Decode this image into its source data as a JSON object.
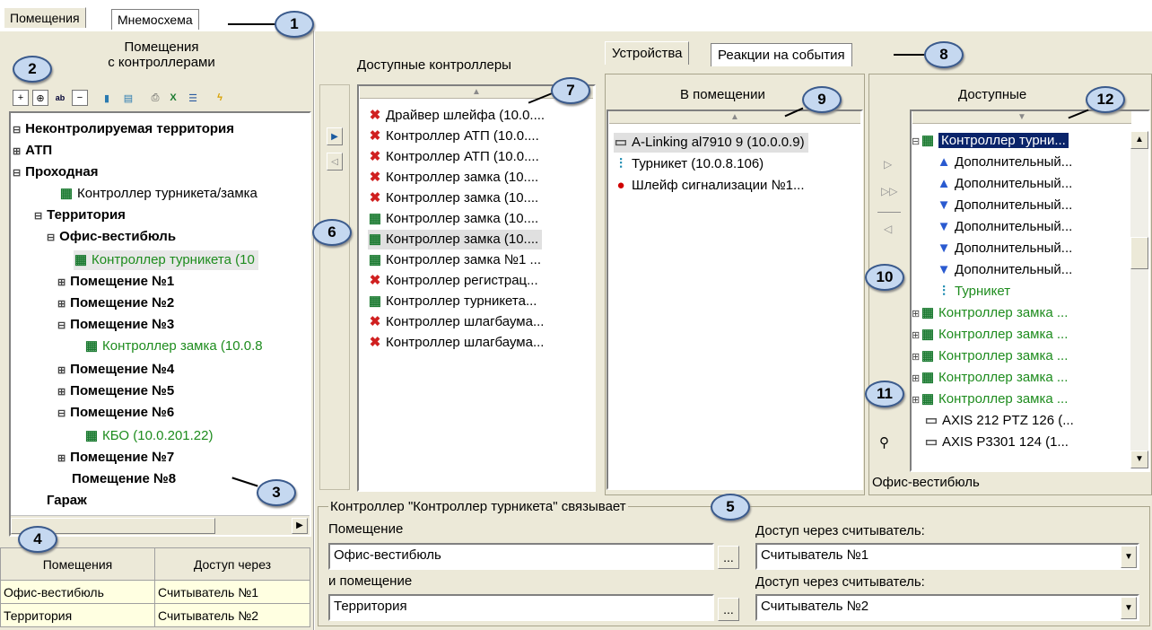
{
  "top_tabs": [
    "Помещения",
    "Мнемосхема"
  ],
  "left": {
    "title_line1": "Помещения",
    "title_line2": "с контроллерами",
    "tree": [
      {
        "label": "Неконтролируемая территория",
        "bold": true
      },
      {
        "label": "АТП",
        "bold": true
      },
      {
        "label": "Проходная",
        "bold": true
      },
      {
        "label": "Контроллер турникета/замка",
        "bold": false
      },
      {
        "label": "Территория",
        "bold": true
      },
      {
        "label": "Офис-вестибюль",
        "bold": true
      },
      {
        "label": "Контроллер турникета (10",
        "bold": false
      },
      {
        "label": "Помещение №1",
        "bold": true
      },
      {
        "label": "Помещение №2",
        "bold": true
      },
      {
        "label": "Помещение №3",
        "bold": true
      },
      {
        "label": "Контроллер замка (10.0.8",
        "bold": false
      },
      {
        "label": "Помещение №4",
        "bold": true
      },
      {
        "label": "Помещение №5",
        "bold": true
      },
      {
        "label": "Помещение №6",
        "bold": true
      },
      {
        "label": "КБО (10.0.201.22)",
        "bold": false
      },
      {
        "label": "Помещение №7",
        "bold": true
      },
      {
        "label": "Помещение №8",
        "bold": true
      },
      {
        "label": "Гараж",
        "bold": true
      }
    ],
    "grid_headers": [
      "Помещения",
      "Доступ через"
    ],
    "grid_rows": [
      [
        "Офис-вестибюль",
        "Считыватель №1"
      ],
      [
        "Территория",
        "Считыватель №2"
      ]
    ]
  },
  "available_controllers": {
    "title": "Доступные контроллеры",
    "items": [
      "Драйвер шлейфа (10.0....",
      "Контроллер АТП (10.0....",
      "Контроллер АТП (10.0....",
      "Контроллер замка (10....",
      "Контроллер замка (10....",
      "Контроллер замка (10....",
      "Контроллер замка (10....",
      "Контроллер замка №1 ...",
      "Контроллер регистрац...",
      "Контроллер турникета...",
      "Контроллер шлагбаума...",
      "Контроллер шлагбаума..."
    ]
  },
  "right_tabs": [
    "Устройства",
    "Реакции на события"
  ],
  "in_room": {
    "title": "В помещении",
    "items": [
      "A-Linking al7910 9 (10.0.0.9)",
      "Турникет (10.0.8.106)",
      "Шлейф сигнализации №1..."
    ]
  },
  "available_devices": {
    "title": "Доступные",
    "items": [
      "Контроллер турни...",
      "Дополнительный...",
      "Дополнительный...",
      "Дополнительный...",
      "Дополнительный...",
      "Дополнительный...",
      "Дополнительный...",
      "Турникет",
      "Контроллер замка ...",
      "Контроллер замка ...",
      "Контроллер замка ...",
      "Контроллер замка ...",
      "Контроллер замка ...",
      "AXIS 212 PTZ 126 (...",
      "AXIS P3301 124 (1..."
    ],
    "footer": "Офис-вестибюль"
  },
  "link_panel": {
    "caption": "Контроллер \"Контроллер турникета\" связывает",
    "room1_label": "Помещение",
    "room1_value": "Офис-вестибюль",
    "room2_label": "и помещение",
    "room2_value": "Территория",
    "reader_label1": "Доступ через считыватель:",
    "reader_value1": "Считыватель №1",
    "reader_label2": "Доступ через считыватель:",
    "reader_value2": "Считыватель №2",
    "ellipsis": "..."
  },
  "callouts": [
    "1",
    "2",
    "3",
    "4",
    "5",
    "6",
    "7",
    "8",
    "9",
    "10",
    "11",
    "12"
  ],
  "colors": {
    "panel": "#ece9d8",
    "callout_fill": "#c5d8f0",
    "green_text": "#1e8c1e",
    "selection": "#0a246a"
  }
}
